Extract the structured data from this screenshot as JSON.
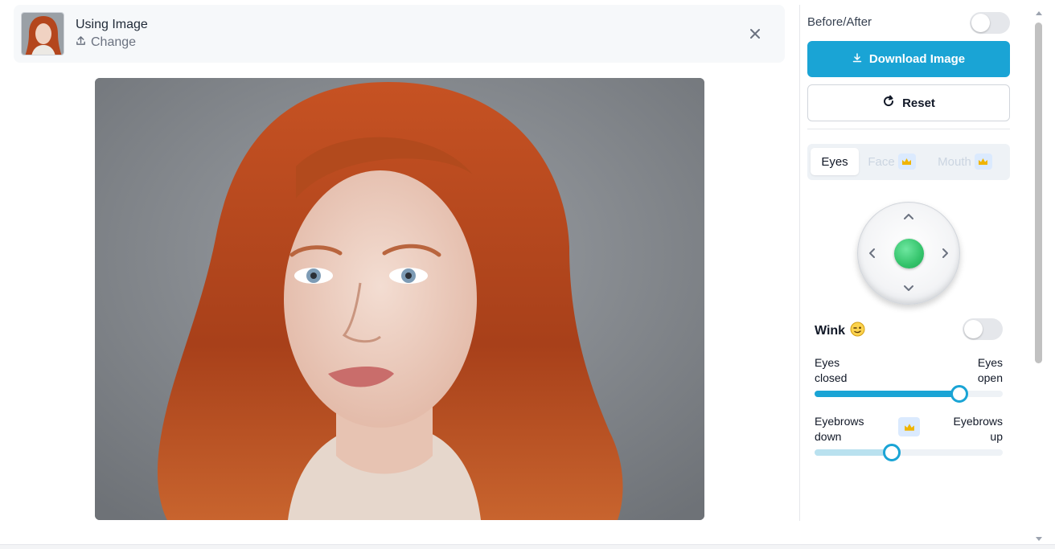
{
  "header": {
    "title": "Using Image",
    "change_label": "Change"
  },
  "panel": {
    "before_after_label": "Before/After",
    "before_after_on": false,
    "download_label": "Download Image",
    "reset_label": "Reset",
    "tabs": [
      {
        "label": "Eyes",
        "active": true
      },
      {
        "label": "Face",
        "active": false,
        "premium": true
      },
      {
        "label": "Mouth",
        "active": false,
        "premium": true
      }
    ],
    "wink_label": "Wink",
    "wink_on": false,
    "sliders": [
      {
        "left_label_1": "Eyes",
        "left_label_2": "closed",
        "right_label_1": "Eyes",
        "right_label_2": "open",
        "value": 0.77,
        "premium": false
      },
      {
        "left_label_1": "Eyebrows",
        "left_label_2": "down",
        "right_label_1": "Eyebrows",
        "right_label_2": "up",
        "value": 0.41,
        "premium": true
      }
    ]
  },
  "colors": {
    "accent": "#1aa4d5",
    "accent_light": "#b9e1ef",
    "joystick_dot": "#34c36b"
  },
  "icons": [
    "upload-icon",
    "close-icon",
    "download-icon",
    "reset-icon",
    "crown-icon",
    "chevron-up-icon",
    "chevron-down-icon",
    "chevron-left-icon",
    "chevron-right-icon",
    "wink-emoji-icon"
  ]
}
